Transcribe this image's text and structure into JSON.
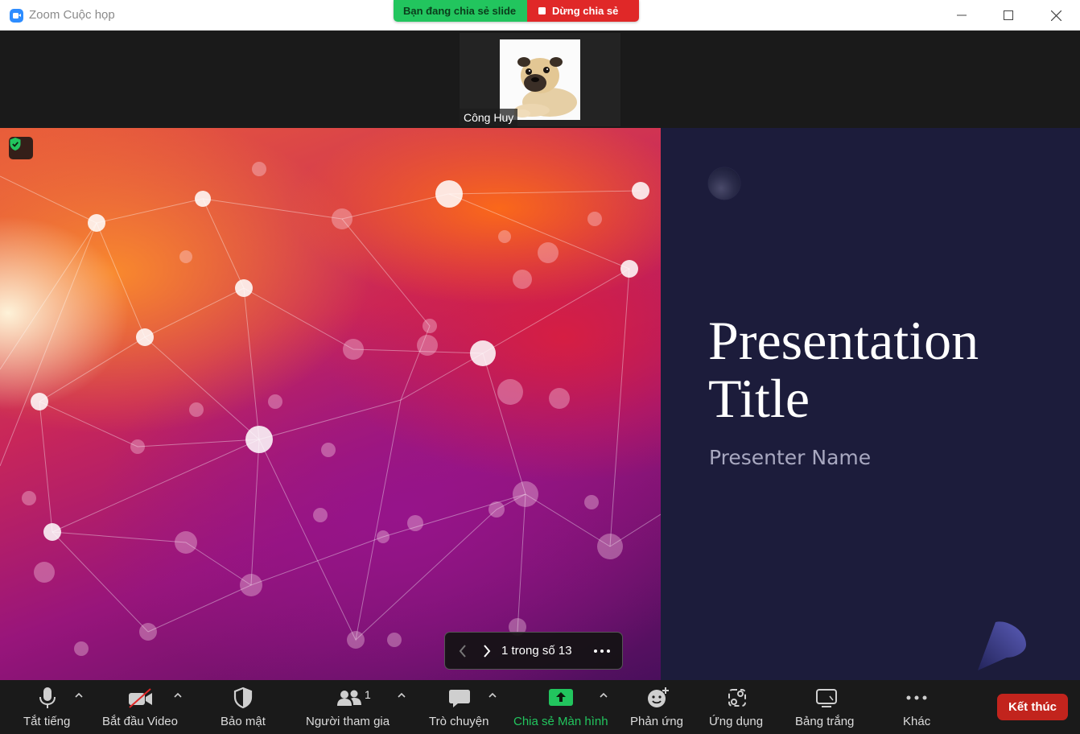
{
  "window": {
    "title": "Zoom Cuộc họp",
    "icon": "zoom-logo-icon"
  },
  "share_banner": {
    "status": "Bạn đang chia sẻ slide",
    "stop_label": "Dừng chia sẻ",
    "status_color": "#22c55e",
    "stop_color": "#e02828"
  },
  "participant": {
    "name": "Công Huy"
  },
  "slide": {
    "title_line1": "Presentation",
    "title_line2": "Title",
    "presenter": "Presenter Name",
    "background_color": "#1c1c3b"
  },
  "slide_nav": {
    "counter": "1 trong số 13"
  },
  "toolbar": {
    "mute": "Tắt tiếng",
    "video": "Bắt đầu Video",
    "security": "Bảo mật",
    "participants": "Người tham gia",
    "participants_count": "1",
    "chat": "Trò chuyện",
    "share": "Chia sẻ Màn hình",
    "reactions": "Phản ứng",
    "apps": "Ứng dụng",
    "whiteboard": "Bảng trắng",
    "more": "Khác",
    "end": "Kết thúc",
    "share_color": "#22c55e",
    "end_color": "#c2241d"
  }
}
